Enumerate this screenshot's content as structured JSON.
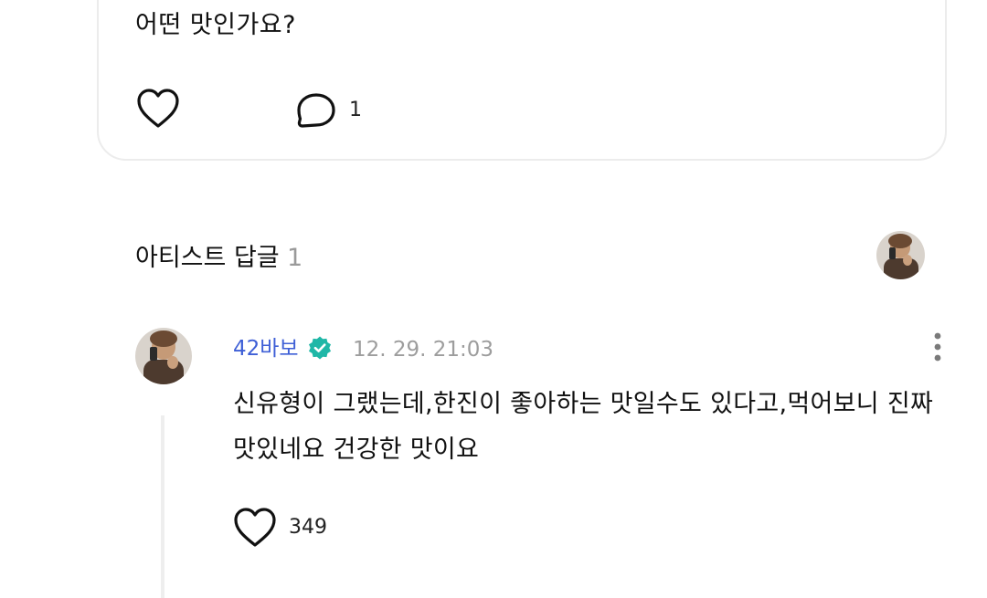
{
  "post": {
    "text": "어떤 맛인가요?",
    "comment_count": "1",
    "icons": {
      "like": "heart-outline-icon",
      "comment": "speech-bubble-icon"
    }
  },
  "artist_replies": {
    "title": "아티스트 답글",
    "count": "1",
    "header_avatar_icon": "artist-avatar"
  },
  "reply": {
    "author": "42바보",
    "timestamp": "12. 29. 21:03",
    "text": "신유형이 그랬는데,한진이 좋아하는 맛일수도 있다고,먹어보니 진짜 맛있네요 건강한 맛이요",
    "like_count": "349",
    "icons": {
      "verified": "verified-badge-icon",
      "more": "more-vertical-icon",
      "like": "heart-outline-icon"
    }
  },
  "colors": {
    "author_link": "#3e5fd6",
    "verified_badge": "#1fb7a7",
    "muted_text": "#9d9d9d",
    "card_border": "#ececec",
    "thread_line": "#eeeeee"
  }
}
